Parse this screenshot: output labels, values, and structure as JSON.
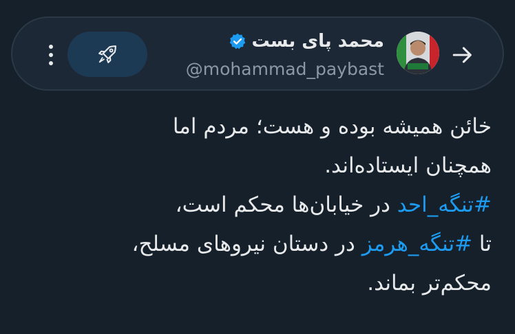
{
  "header": {
    "display_name": "محمد پای بست",
    "handle": "@mohammad_paybast",
    "back_icon": "arrow-right-icon",
    "verified_icon": "verified-badge-icon",
    "boost_icon": "rocket-icon",
    "more_icon": "vertical-ellipsis-icon",
    "accent_color": "#1d9bf0"
  },
  "tweet": {
    "line1": "خائن همیشه بوده و هست؛ مردم اما",
    "line2": "همچنان ایستاده‌اند.",
    "line3_hashtag": "#تنگه_احد",
    "line3_rest": " در خیابان‌ها محکم است،",
    "line4_prefix": "تا ",
    "line4_hashtag": "#تنگه_هرمز",
    "line4_rest": " در دستان نیروهای مسلح،",
    "line5": "محکم‌تر بماند."
  }
}
